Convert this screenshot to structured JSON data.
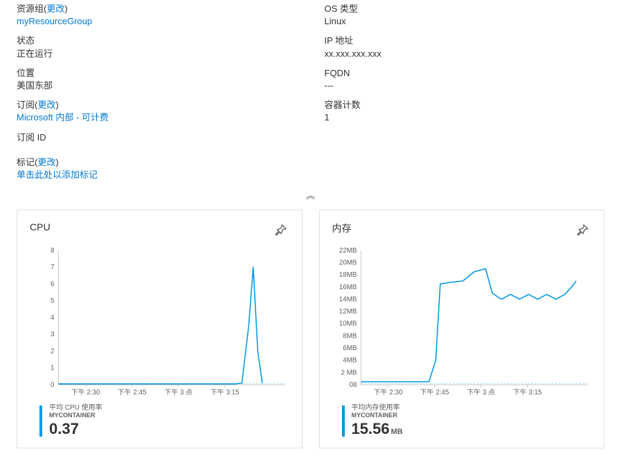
{
  "left": {
    "resourceGroup": {
      "label": "资源组",
      "change": "更改",
      "value": "myResourceGroup"
    },
    "status": {
      "label": "状态",
      "value": "正在运行"
    },
    "location": {
      "label": "位置",
      "value": "美国东部"
    },
    "subscription": {
      "label": "订阅",
      "change": "更改",
      "value": "Microsoft 内部 - 可计费"
    },
    "subscriptionId": {
      "label": "订阅 ID",
      "value": ""
    }
  },
  "right": {
    "osType": {
      "label": "OS 类型",
      "value": "Linux"
    },
    "ip": {
      "label": "IP 地址",
      "value": "xx.xxx.xxx.xxx"
    },
    "fqdn": {
      "label": "FQDN",
      "value": "---"
    },
    "containers": {
      "label": "容器计数",
      "value": "1"
    }
  },
  "tags": {
    "label": "标记",
    "change": "更改",
    "addHint": "单击此处以添加标记"
  },
  "collapseGlyph": "︽",
  "charts": {
    "cpu": {
      "title": "CPU",
      "legendLabel": "平均 CPU 使用率",
      "legendSub": "MYCONTAINER",
      "legendValue": "0.37"
    },
    "mem": {
      "title": "内存",
      "legendLabel": "平均内存使用率",
      "legendSub": "MYCONTAINER",
      "legendValue": "15.56",
      "legendUnit": "MB"
    }
  },
  "chart_data": [
    {
      "type": "line",
      "title": "CPU",
      "xlabel": "",
      "ylabel": "",
      "ylim": [
        0,
        8
      ],
      "yticks": [
        0,
        1,
        2,
        3,
        4,
        5,
        6,
        7,
        8
      ],
      "categories": [
        "下午 2:30",
        "下午 2:45",
        "下午 3 点",
        "下午 3:15"
      ],
      "series": [
        {
          "name": "平均 CPU 使用率 MYCONTAINER",
          "color": "#0099e5",
          "x_rel": [
            0.0,
            0.06,
            0.12,
            0.18,
            0.24,
            0.3,
            0.36,
            0.42,
            0.48,
            0.54,
            0.6,
            0.66,
            0.72,
            0.78,
            0.81,
            0.84,
            0.86,
            0.88,
            0.9
          ],
          "values": [
            0.05,
            0.05,
            0.05,
            0.05,
            0.05,
            0.05,
            0.05,
            0.05,
            0.05,
            0.05,
            0.05,
            0.05,
            0.05,
            0.05,
            0.1,
            3.5,
            7.0,
            2.0,
            0.1
          ]
        }
      ],
      "summary": 0.37
    },
    {
      "type": "line",
      "title": "内存",
      "xlabel": "",
      "ylabel": "",
      "ylim": [
        0,
        22
      ],
      "yticks": [
        0,
        2,
        4,
        6,
        8,
        10,
        12,
        14,
        16,
        18,
        20,
        22
      ],
      "yticklabels": [
        "08",
        "2 MB",
        "4MB",
        "6MB",
        "8MB",
        "10MB",
        "12MB",
        "14MB",
        "16MB",
        "18MB",
        "20MB",
        "22MB"
      ],
      "categories": [
        "下午 2:30",
        "下午 2:45",
        "下午 3 点",
        "下午 3:15"
      ],
      "series": [
        {
          "name": "平均内存使用率 MYCONTAINER",
          "color": "#0099e5",
          "x_rel": [
            0.0,
            0.06,
            0.12,
            0.18,
            0.24,
            0.3,
            0.33,
            0.35,
            0.4,
            0.45,
            0.5,
            0.55,
            0.58,
            0.62,
            0.66,
            0.7,
            0.74,
            0.78,
            0.82,
            0.86,
            0.9,
            0.93,
            0.95
          ],
          "values": [
            0.5,
            0.5,
            0.5,
            0.5,
            0.5,
            0.5,
            4.0,
            16.5,
            16.8,
            17.0,
            18.5,
            19.0,
            15.0,
            14.0,
            14.8,
            14.0,
            14.8,
            14.0,
            14.8,
            14.0,
            14.8,
            16.0,
            17.0
          ]
        }
      ],
      "summary": 15.56,
      "unit": "MB"
    }
  ]
}
